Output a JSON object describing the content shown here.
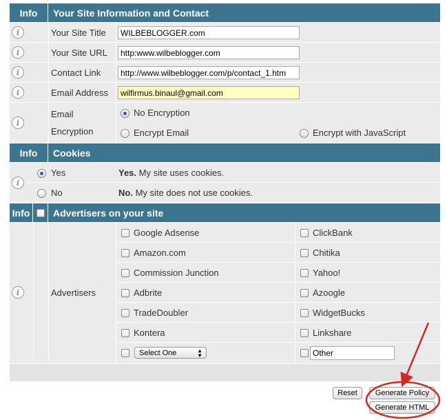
{
  "colors": {
    "header": "#3b7590",
    "highlight_field": "#ffffc0",
    "annotation": "#d9261c"
  },
  "site_section": {
    "info_header": "Info",
    "title": "Your Site Information and Contact",
    "rows": [
      {
        "label": "Your Site Title",
        "value": "WILBEBLOGGER.com"
      },
      {
        "label": "Your Site URL",
        "value": "http:www.wilbeblogger.com"
      },
      {
        "label": "Contact Link",
        "value": "http://www.wilbeblogger.com/p/contact_1.htm"
      },
      {
        "label": "Email Address",
        "value": "wilfirmus.binaul@gmail.com"
      }
    ],
    "encryption": {
      "label_line1": "Email",
      "label_line2": "Encryption",
      "options": [
        "No Encryption",
        "Encrypt Email",
        "Encrypt with JavaScript"
      ],
      "selected": "No Encryption"
    }
  },
  "cookies_section": {
    "info_header": "Info",
    "title": "Cookies",
    "options": [
      {
        "label": "Yes",
        "bold": "Yes.",
        "desc": "My site uses cookies.",
        "selected": true
      },
      {
        "label": "No",
        "bold": "No.",
        "desc": "My site does not use cookies.",
        "selected": false
      }
    ]
  },
  "advertisers_section": {
    "info_header": "Info",
    "title": "Advertisers on your site",
    "row_label": "Advertisers",
    "left": [
      "Google Adsense",
      "Amazon.com",
      "Commission Junction",
      "Adbrite",
      "TradeDoubler",
      "Kontera"
    ],
    "right": [
      "ClickBank",
      "Chitika",
      "Yahoo!",
      "Azoogle",
      "WidgetBucks",
      "Linkshare"
    ],
    "select_value": "Select One",
    "other_value": "Other"
  },
  "buttons": {
    "reset": "Reset",
    "generate_policy": "Generate Policy",
    "generate_html": "Generate HTML"
  }
}
